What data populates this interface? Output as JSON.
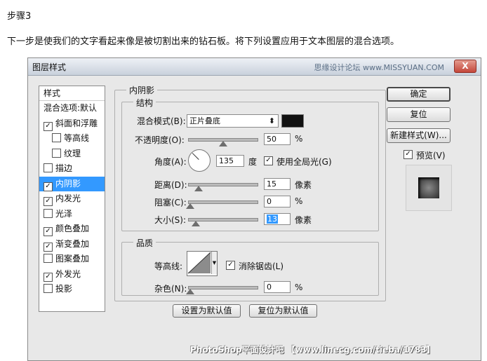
{
  "step_title": "步骤3",
  "intro_text": "下一步是使我们的文字看起来像是被切割出来的钻石板。将下列设置应用于文本图层的混合选项。",
  "dialog": {
    "title": "图层样式",
    "watermark": "思缘设计论坛 www.MISSYUAN.COM",
    "close_label": "X"
  },
  "left_panel": {
    "header": "样式",
    "items": [
      {
        "label": "混合选项:默认",
        "checkbox": false,
        "checked": false,
        "indent": false,
        "selected": false
      },
      {
        "label": "斜面和浮雕",
        "checkbox": true,
        "checked": true,
        "indent": false,
        "selected": false
      },
      {
        "label": "等高线",
        "checkbox": true,
        "checked": false,
        "indent": true,
        "selected": false
      },
      {
        "label": "纹理",
        "checkbox": true,
        "checked": false,
        "indent": true,
        "selected": false
      },
      {
        "label": "描边",
        "checkbox": true,
        "checked": false,
        "indent": false,
        "selected": false
      },
      {
        "label": "内阴影",
        "checkbox": true,
        "checked": true,
        "indent": false,
        "selected": true
      },
      {
        "label": "内发光",
        "checkbox": true,
        "checked": true,
        "indent": false,
        "selected": false
      },
      {
        "label": "光泽",
        "checkbox": true,
        "checked": false,
        "indent": false,
        "selected": false
      },
      {
        "label": "颜色叠加",
        "checkbox": true,
        "checked": true,
        "indent": false,
        "selected": false
      },
      {
        "label": "渐变叠加",
        "checkbox": true,
        "checked": true,
        "indent": false,
        "selected": false
      },
      {
        "label": "图案叠加",
        "checkbox": true,
        "checked": false,
        "indent": false,
        "selected": false
      },
      {
        "label": "外发光",
        "checkbox": true,
        "checked": true,
        "indent": false,
        "selected": false
      },
      {
        "label": "投影",
        "checkbox": true,
        "checked": false,
        "indent": false,
        "selected": false
      }
    ]
  },
  "inner_shadow": {
    "section_title": "内阴影",
    "structure": {
      "title": "结构",
      "blend_mode_label": "混合模式(B):",
      "blend_mode_value": "正片叠底",
      "blend_color": "#111111",
      "opacity_label": "不透明度(O):",
      "opacity_value": "50",
      "opacity_fraction": 0.5,
      "opacity_unit": "%",
      "angle_label": "角度(A):",
      "angle_value": "135",
      "angle_unit": "度",
      "global_light_label": "使用全局光(G)",
      "global_light_checked": true,
      "distance_label": "距离(D):",
      "distance_value": "15",
      "distance_unit": "像素",
      "choke_label": "阻塞(C):",
      "choke_value": "0",
      "choke_unit": "%",
      "size_label": "大小(S):",
      "size_value": "13",
      "size_unit": "像素"
    },
    "quality": {
      "title": "品质",
      "contour_label": "等高线:",
      "antialias_label": "消除锯齿(L)",
      "antialias_checked": true,
      "noise_label": "杂色(N):",
      "noise_value": "0",
      "noise_unit": "%"
    },
    "set_default_label": "设置为默认值",
    "reset_default_label": "复位为默认值"
  },
  "right_buttons": {
    "ok": "确定",
    "reset": "复位",
    "new_style": "新建样式(W)...",
    "preview_label": "预览(V)",
    "preview_checked": true
  },
  "footer_watermark": "PhotoShop平面设计吧 【www.linecg.com/tieba/1783】"
}
